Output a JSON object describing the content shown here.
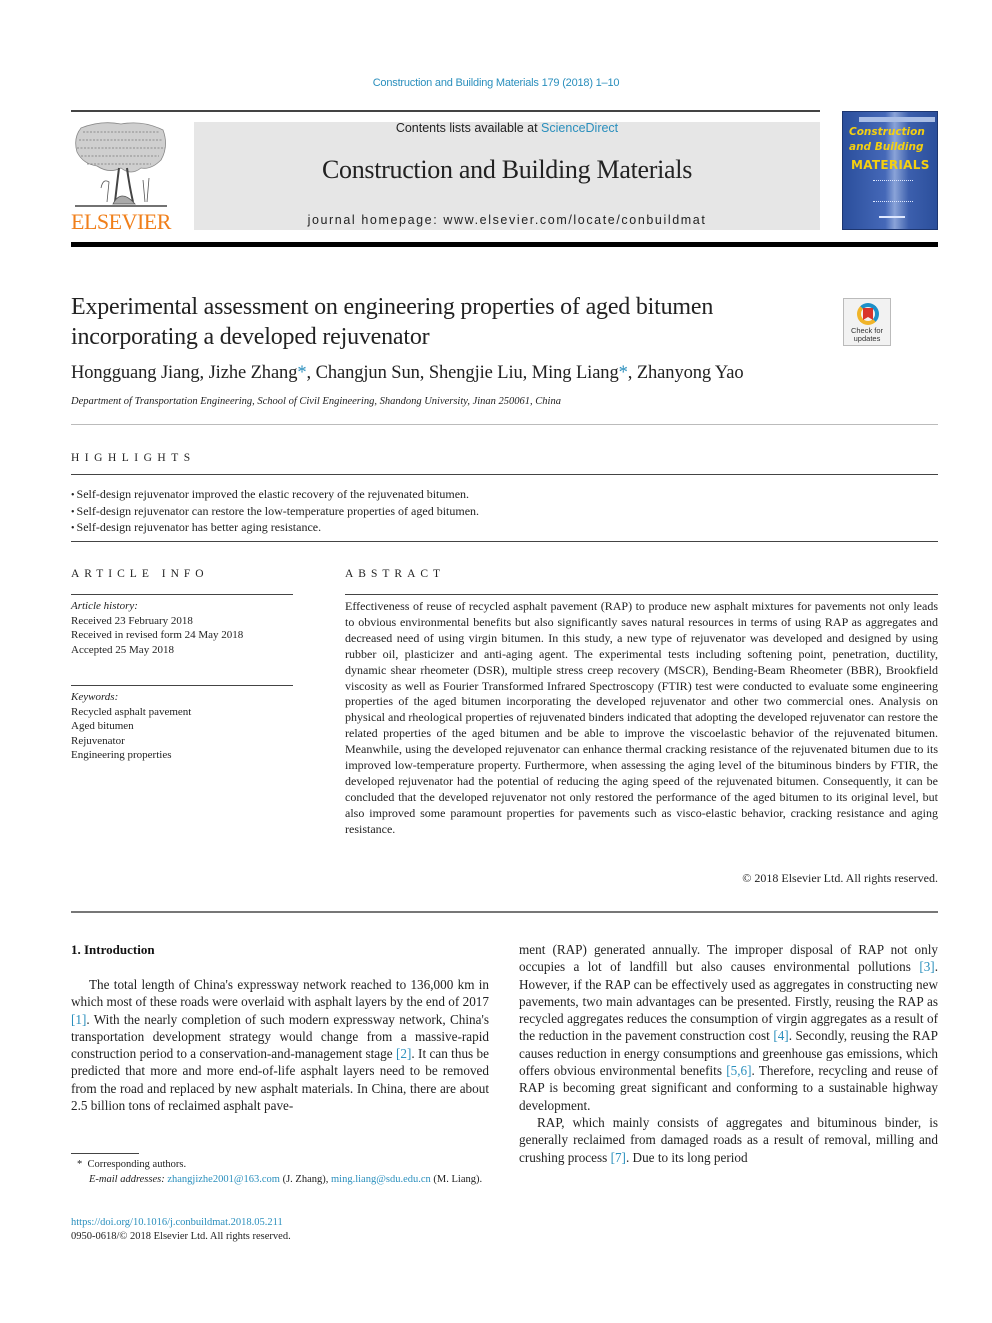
{
  "header": {
    "journal_reference": "Construction and Building Materials 179 (2018) 1–10",
    "contents_prefix": "Contents lists available at ",
    "contents_link": "ScienceDirect",
    "journal_title": "Construction and Building Materials",
    "homepage_prefix": "journal homepage: ",
    "homepage_url": "www.elsevier.com/locate/conbuildmat",
    "publisher_logo_text": "ELSEVIER",
    "cover": {
      "line1": "Construction",
      "line2": "and Building",
      "line3": "MATERIALS"
    },
    "colors": {
      "link": "#2a8fbd",
      "elsevier_orange": "#f07f1a",
      "cover_blue": "#2b4f9c",
      "cover_yellow": "#f5d010",
      "header_box": "#e6e6e6"
    }
  },
  "article": {
    "title": "Experimental assessment on engineering properties of aged bitumen incorporating a developed rejuvenator",
    "check_updates_label_1": "Check for",
    "check_updates_label_2": "updates",
    "authors": [
      {
        "name": "Hongguang Jiang",
        "corresponding": false
      },
      {
        "name": "Jizhe Zhang",
        "corresponding": true
      },
      {
        "name": "Changjun Sun",
        "corresponding": false
      },
      {
        "name": "Shengjie Liu",
        "corresponding": false
      },
      {
        "name": "Ming Liang",
        "corresponding": true
      },
      {
        "name": "Zhanyong Yao",
        "corresponding": false
      }
    ],
    "affiliation": "Department of Transportation Engineering, School of Civil Engineering, Shandong University, Jinan 250061, China"
  },
  "highlights": {
    "heading": "HIGHLIGHTS",
    "items": [
      "Self-design rejuvenator improved the elastic recovery of the rejuvenated bitumen.",
      "Self-design rejuvenator can restore the low-temperature properties of aged bitumen.",
      "Self-design rejuvenator has better aging resistance."
    ]
  },
  "article_info": {
    "heading": "ARTICLE INFO",
    "history_label": "Article history:",
    "history": [
      "Received 23 February 2018",
      "Received in revised form 24 May 2018",
      "Accepted 25 May 2018"
    ],
    "keywords_label": "Keywords:",
    "keywords": [
      "Recycled asphalt pavement",
      "Aged bitumen",
      "Rejuvenator",
      "Engineering properties"
    ]
  },
  "abstract": {
    "heading": "ABSTRACT",
    "text": "Effectiveness of reuse of recycled asphalt pavement (RAP) to produce new asphalt mixtures for pave­ments not only leads to obvious environmental benefits but also significantly saves natural resources in terms of using RAP as aggregates and decreased need of using virgin bitumen. In this study, a new type of rejuvenator was developed and designed by using rubber oil, plasticizer and anti-aging agent. The experimental tests including softening point, penetration, ductility, dynamic shear rheometer (DSR), mul­tiple stress creep recovery (MSCR), Bending-Beam Rheometer (BBR), Brookfield viscosity as well as Fourier Transformed Infrared Spectroscopy (FTIR) test were conducted to evaluate some engineering properties of the aged bitumen incorporating the developed rejuvenator and other two commercial ones. Analysis on physical and rheological properties of rejuvenated binders indicated that adopting the devel­oped rejuvenator can restore the related properties of the aged bitumen and be able to improve the visco­elastic behavior of the rejuvenated bitumen. Meanwhile, using the developed rejuvenator can enhance thermal cracking resistance of the rejuvenated bitumen due to its improved low-temperature property. Furthermore, when assessing the aging level of the bituminous binders by FTIR, the developed rejuvena­tor had the potential of reducing the aging speed of the rejuvenated bitumen. Consequently, it can be con­cluded that the developed rejuvenator not only restored the performance of the aged bitumen to its original level, but also improved some paramount properties for pavements such as visco-elastic behav­ior, cracking resistance and aging resistance.",
    "copyright": "© 2018 Elsevier Ltd. All rights reserved."
  },
  "introduction": {
    "heading": "1. Introduction",
    "left_column": {
      "p1_a": "The total length of China's expressway network reached to 136,000 km in which most of these roads were overlaid with asphalt layers by the end of 2017 ",
      "cite1": "[1]",
      "p1_b": ". With the nearly completion of such modern expressway network, China's transportation devel­opment strategy would change from a massive-rapid construction period to a conservation-and-management stage ",
      "cite2": "[2]",
      "p1_c": ". It can thus be predicted that more and more end-of-life asphalt layers need to be removed from the road and replaced by new asphalt materials. In China, there are about 2.5 billion tons of reclaimed asphalt pave-"
    },
    "right_column": {
      "p1_a": "ment (RAP) generated annually. The improper disposal of RAP not only occupies a lot of landfill but also causes environmental pollutions ",
      "cite3": "[3]",
      "p1_b": ". However, if the RAP can be effectively used as aggre­gates in constructing new pavements, two main advantages can be presented. Firstly, reusing the RAP as recycled aggregates reduces the consumption of virgin aggregates as a result of the reduction in the pavement construction cost ",
      "cite4": "[4]",
      "p1_c": ". Secondly, reusing the RAP causes reduction in energy consumptions and greenhouse gas emissions, which offers obvious environmental benefits ",
      "cite56": "[5,6]",
      "p1_d": ". Therefore, recycling and reuse of RAP is becoming great significant and conforming to a sustainable highway development.",
      "p2_a": "RAP, which mainly consists of aggregates and bituminous bin­der, is generally reclaimed from damaged roads as a result of removal, milling and crushing process ",
      "cite7": "[7]",
      "p2_b": ". Due to its long period"
    }
  },
  "footnotes": {
    "corresponding_mark": "*",
    "corresponding_text": "Corresponding authors.",
    "email_label": "E-mail addresses:",
    "email1": "zhangjizhe2001@163.com",
    "email1_owner": " (J. Zhang), ",
    "email2": "ming.liang@sdu.edu.cn",
    "email2_owner": " (M. Liang).",
    "doi": "https://doi.org/10.1016/j.conbuildmat.2018.05.211",
    "issn_copyright": "0950-0618/© 2018 Elsevier Ltd. All rights reserved."
  }
}
